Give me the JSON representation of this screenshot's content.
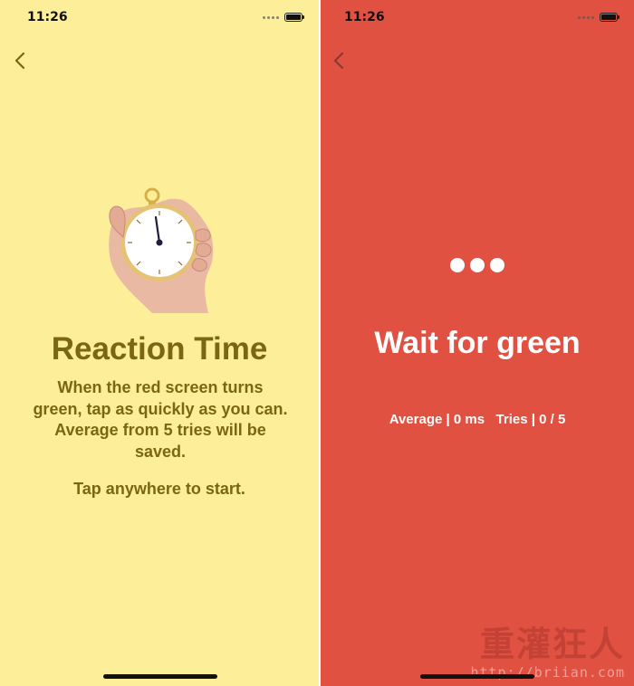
{
  "screens": {
    "intro": {
      "status_time": "11:26",
      "title": "Reaction Time",
      "description": "When the red screen turns green, tap as quickly as you can. Average from 5 tries will be saved.",
      "hint": "Tap anywhere to start.",
      "colors": {
        "background": "#fdee9a",
        "text": "#7b6713"
      },
      "icons": [
        "back-chevron-icon",
        "stopwatch-in-hand-icon",
        "battery-icon"
      ]
    },
    "waiting": {
      "status_time": "11:26",
      "title": "Wait for green",
      "stats": "Average | 0 ms   Tries | 0 / 5",
      "colors": {
        "background": "#e05142",
        "text": "#ffffff"
      },
      "icons": [
        "back-chevron-icon",
        "loading-dots-icon",
        "battery-icon"
      ]
    }
  },
  "watermark": {
    "logo": "重灌狂人",
    "url": "http://briian.com"
  }
}
